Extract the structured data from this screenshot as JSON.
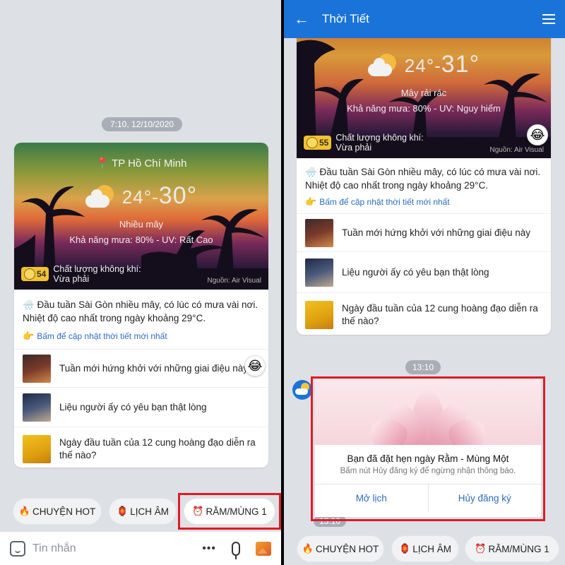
{
  "left": {
    "timestamp": "7:10, 12/10/2020",
    "weather": {
      "location": "TP Hồ Chí Minh",
      "temp_low": "24°",
      "temp_sep": "-",
      "temp_high": "30°",
      "condition": "Nhiều mây",
      "rain_uv": "Khả năng mưa: 80% - UV: Rất Cao",
      "aq_value": "54",
      "aq_label": "Chất lượng không khí:",
      "aq_status": "Vừa phải",
      "source": "Nguồn: Air Visual"
    },
    "news_text": "🌧️ Đầu tuần Sài Gòn nhiều mây, có lúc có mưa vài nơi. Nhiệt độ cao nhất trong ngày khoảng 29°C.",
    "update_link": "Bấm để cập nhật thời tiết mới nhất",
    "items": [
      {
        "label": "Tuần mới hứng khởi với những giai điệu này"
      },
      {
        "label": "Liệu người ấy có yêu bạn thật lòng"
      },
      {
        "label": "Ngày đầu tuần của 12 cung hoàng đạo diễn ra thế nào?"
      }
    ],
    "emoji": "😂",
    "chips": [
      {
        "icon": "🔥",
        "label": "CHUYỆN HOT"
      },
      {
        "icon": "🏮",
        "label": "LỊCH ÂM"
      },
      {
        "icon": "⏰",
        "label": "RẰM/MÙNG 1"
      }
    ],
    "input_placeholder": "Tin nhắn",
    "more": "•••"
  },
  "right": {
    "header_title": "Thời Tiết",
    "back": "←",
    "weather": {
      "temp_low": "24°",
      "temp_sep": "-",
      "temp_high": "31°",
      "condition": "Mây rải rác",
      "rain_uv": "Khả năng mưa: 80% - UV: Nguy hiểm",
      "aq_value": "55",
      "aq_label": "Chất lượng không khí:",
      "aq_status": "Vừa phải",
      "source": "Nguồn: Air Visual"
    },
    "news_text": "🌧️ Đầu tuần Sài Gòn nhiều mây, có lúc có mưa vài nơi. Nhiệt độ cao nhất trong ngày khoảng 29°C.",
    "update_link": "Bấm để cập nhật thời tiết mới nhất",
    "items": [
      {
        "label": "Tuần mới hứng khởi với những giai điệu này"
      },
      {
        "label": "Liệu người ấy có yêu bạn thật lòng"
      },
      {
        "label": "Ngày đầu tuần của 12 cung hoàng đạo diễn ra thế nào?"
      }
    ],
    "emoji": "😂",
    "timestamp": "13:10",
    "timestamp2": "13:10",
    "popup": {
      "title": "Bạn đã đặt hẹn ngày Rằm - Mùng Một",
      "subtitle": "Bấm nút Hủy đăng ký để ngừng nhận thông báo.",
      "open_label": "Mở lịch",
      "cancel_label": "Hủy đăng ký"
    },
    "chips": [
      {
        "icon": "🔥",
        "label": "CHUYỆN HOT"
      },
      {
        "icon": "🏮",
        "label": "LỊCH ÂM"
      },
      {
        "icon": "⏰",
        "label": "RẰM/MÙNG 1"
      }
    ]
  },
  "colors": {
    "header": "#1a73d8",
    "highlight": "#e01b24",
    "link": "#2b6cc4"
  }
}
